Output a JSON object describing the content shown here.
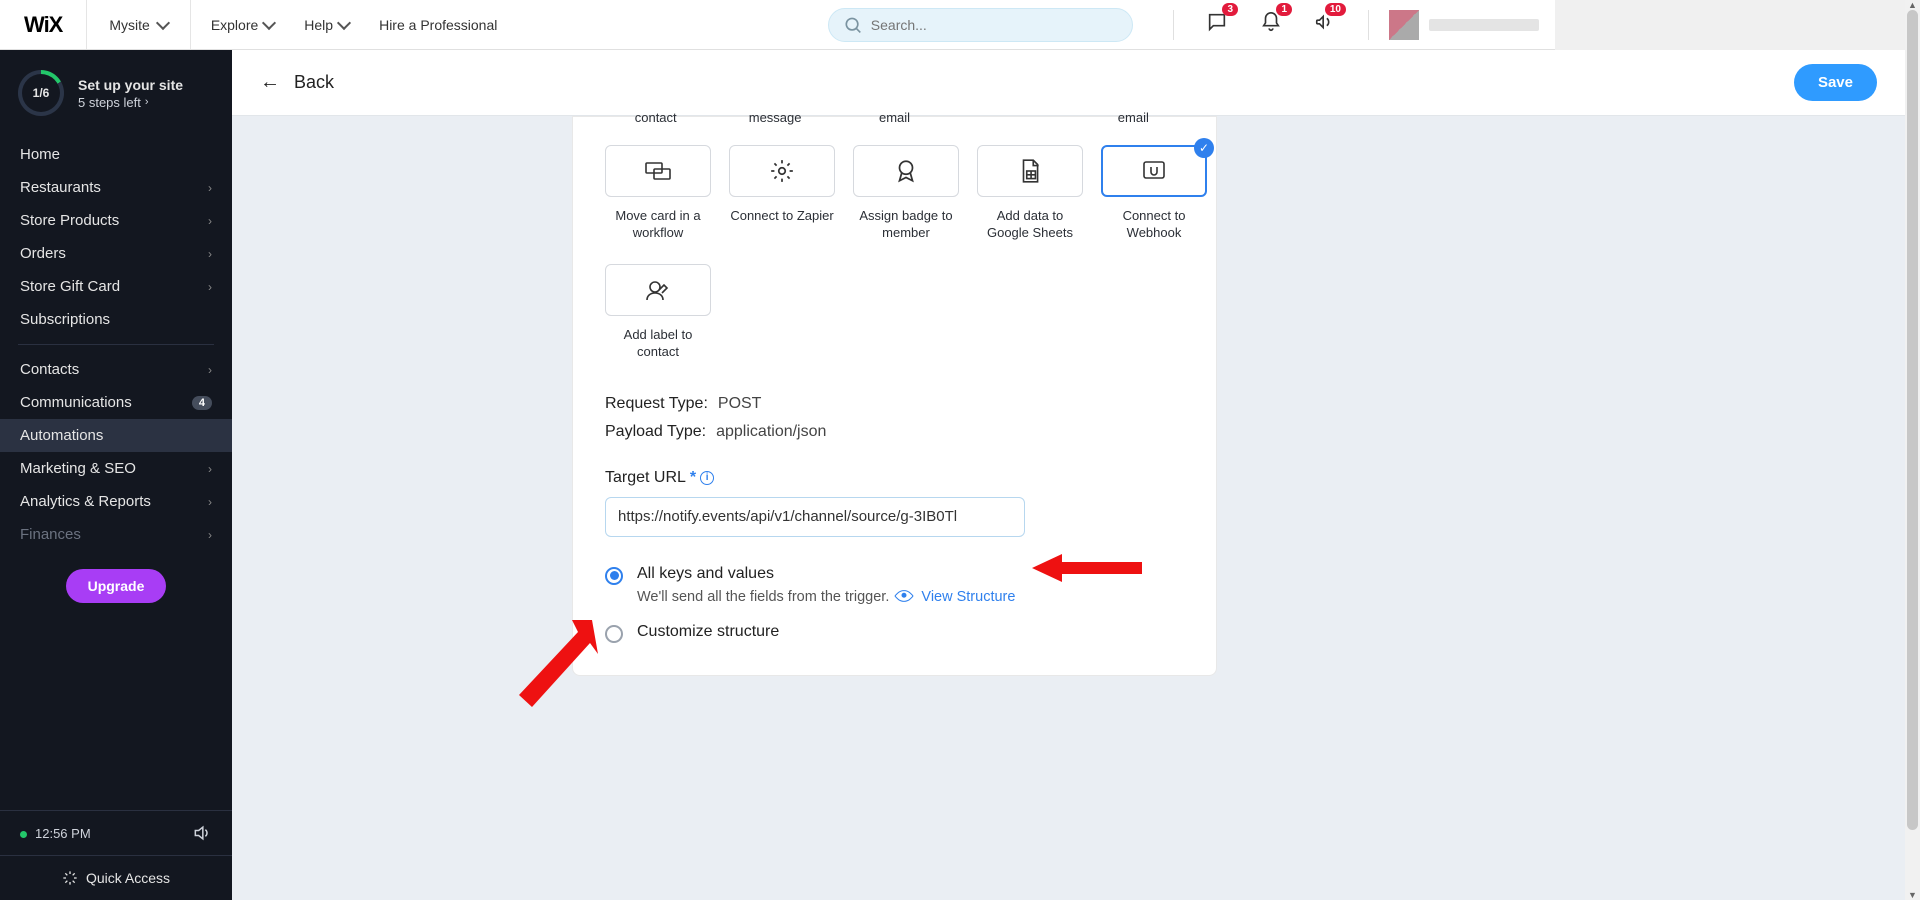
{
  "top": {
    "logo": "WiX",
    "site": "Mysite",
    "menu": {
      "explore": "Explore",
      "help": "Help",
      "hire": "Hire a Professional"
    },
    "search_placeholder": "Search...",
    "badges": {
      "chat": "3",
      "bell": "1",
      "speaker": "10"
    }
  },
  "setup": {
    "progress": "1/6",
    "title": "Set up your site",
    "sub": "5 steps left"
  },
  "sidebar": {
    "items": [
      {
        "label": "Home",
        "chev": false
      },
      {
        "label": "Restaurants",
        "chev": true
      },
      {
        "label": "Store Products",
        "chev": true
      },
      {
        "label": "Orders",
        "chev": true
      },
      {
        "label": "Store Gift Card",
        "chev": true
      },
      {
        "label": "Subscriptions",
        "chev": false
      }
    ],
    "sep": true,
    "items2": [
      {
        "label": "Contacts",
        "chev": true
      },
      {
        "label": "Communications",
        "badge": "4"
      },
      {
        "label": "Automations",
        "active": true
      },
      {
        "label": "Marketing & SEO",
        "chev": true
      },
      {
        "label": "Analytics & Reports",
        "chev": true
      },
      {
        "label": "Finances",
        "chev": true,
        "faded": true
      }
    ],
    "upgrade": "Upgrade",
    "time": "12:56 PM",
    "quick": "Quick Access"
  },
  "subheader": {
    "back": "Back",
    "save": "Save"
  },
  "actions_row0": [
    {
      "label": "contact"
    },
    {
      "label": "message"
    },
    {
      "label": "email"
    },
    {
      "label": ""
    },
    {
      "label": "email"
    }
  ],
  "actions": [
    {
      "label": "Move card in a workflow",
      "icon": "cards"
    },
    {
      "label": "Connect to Zapier",
      "icon": "gear"
    },
    {
      "label": "Assign badge to member",
      "icon": "badge"
    },
    {
      "label": "Add data to Google Sheets",
      "icon": "sheet"
    },
    {
      "label": "Connect to Webhook",
      "icon": "webhook",
      "selected": true
    }
  ],
  "actions2": [
    {
      "label": "Add label to contact",
      "icon": "contact-label"
    }
  ],
  "kv": {
    "request_k": "Request Type:",
    "request_v": "POST",
    "payload_k": "Payload Type:",
    "payload_v": "application/json"
  },
  "target": {
    "label": "Target URL",
    "value": "https://notify.events/api/v1/channel/source/g-3IB0Tl"
  },
  "radios": {
    "all_title": "All keys and values",
    "all_desc": "We'll send all the fields from the trigger.",
    "view": "View Structure",
    "custom_title": "Customize structure"
  }
}
